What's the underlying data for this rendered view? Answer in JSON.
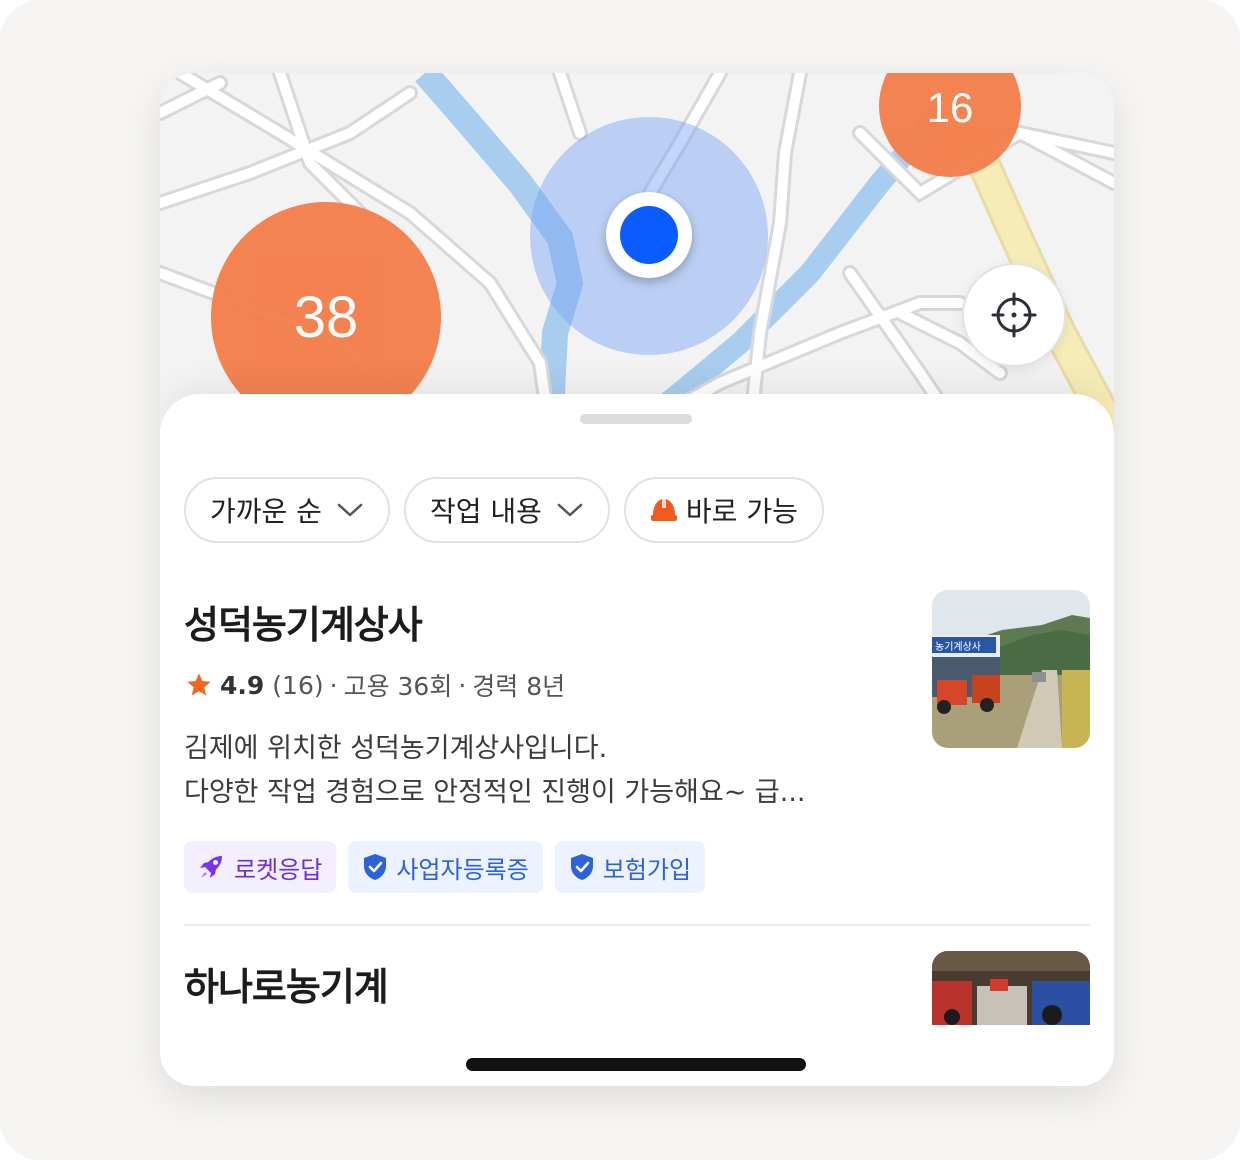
{
  "map": {
    "clusters": [
      {
        "id": "a",
        "count": "38"
      },
      {
        "id": "b",
        "count": "16"
      }
    ],
    "recenter_icon": "crosshair-icon"
  },
  "filters": [
    {
      "label": "가까운 순",
      "icon": "chevron-down-icon"
    },
    {
      "label": "작업 내용",
      "icon": "chevron-down-icon"
    },
    {
      "label": "바로 가능",
      "icon": "helmet-icon"
    }
  ],
  "listings": [
    {
      "name": "성덕농기계상사",
      "rating": "4.9",
      "review_count": "(16)",
      "hires": "고용 36회",
      "experience": "경력 8년",
      "description_line1": "김제에 위치한 성덕농기계상사입니다.",
      "description_line2": "다양한 작업 경험으로 안정적인 진행이 가능해요~ 급...",
      "badges": [
        "로켓응답",
        "사업자등록증",
        "보험가입"
      ],
      "thumb_sign": "농기계상사"
    },
    {
      "name": "하나로농기계"
    }
  ],
  "colors": {
    "accent_orange": "#f37f4b",
    "location_blue": "#0a5cff",
    "badge_purple": "#6a2ed8",
    "badge_blue": "#2e63d8",
    "star": "#f26522"
  }
}
